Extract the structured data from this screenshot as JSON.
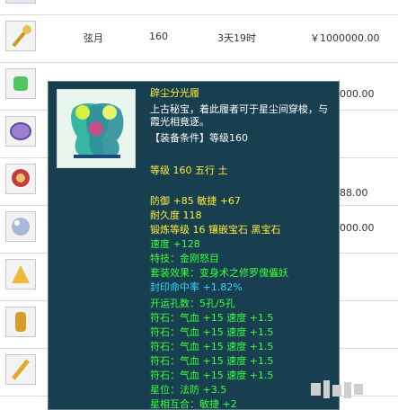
{
  "rows": [
    {
      "name": "",
      "level": "",
      "time": "",
      "price": ""
    },
    {
      "name": "弦月",
      "level": "160",
      "time": "3天19时",
      "price": "￥1000000.00"
    },
    {
      "name": "",
      "level": "",
      "time": "",
      "price": "000.00"
    },
    {
      "name": "",
      "level": "",
      "time": "",
      "price": ""
    },
    {
      "name": "",
      "level": "",
      "time": "",
      "price": "88.00"
    },
    {
      "name": "",
      "level": "",
      "time": "",
      "price": "000.00"
    },
    {
      "name": "",
      "level": "",
      "time": "",
      "price": ""
    },
    {
      "name": "",
      "level": "",
      "time": "",
      "price": ""
    },
    {
      "name": "",
      "level": "",
      "time": "",
      "price": ""
    }
  ],
  "tooltip": {
    "name": "辟尘分光履",
    "desc_line1": "上古秘宝，着此履者可于星尘间穿梭，与",
    "desc_line2": "霞光相竟逐。",
    "equip_req": "【装备条件】等级160",
    "level_line": "等级 160 五行 土",
    "defense_line": "防御 +85 敏捷 +67",
    "durability": "耐久度 118",
    "forge_line": "锻炼等级 16 镶嵌宝石 黑宝石",
    "speed_line": "速度 +128",
    "special_skill": "特技：金刚怒目",
    "set_effect": "套装效果：变身术之修罗傀儡妖",
    "seal_rate": "封印命中率 +1.82%",
    "holes": "开运孔数：5孔/5孔",
    "rune_lines": [
      "符石：气血 +15 速度 +1.5",
      "符石：气血 +15 速度 +1.5",
      "符石：气血 +15 速度 +1.5",
      "符石：气血 +15 速度 +1.5",
      "符石：气血 +15 速度 +1.5"
    ],
    "star_line": "星位：法防 +3.5",
    "star_combo": "星相互合：敏捷 +2"
  },
  "colors": {
    "yellow": "#ffee3c",
    "green": "#3cff3c",
    "cyan": "#36d6ff",
    "white": "#ffffff",
    "price": "#d8457a",
    "tooltip_bg": "#173f4f"
  }
}
